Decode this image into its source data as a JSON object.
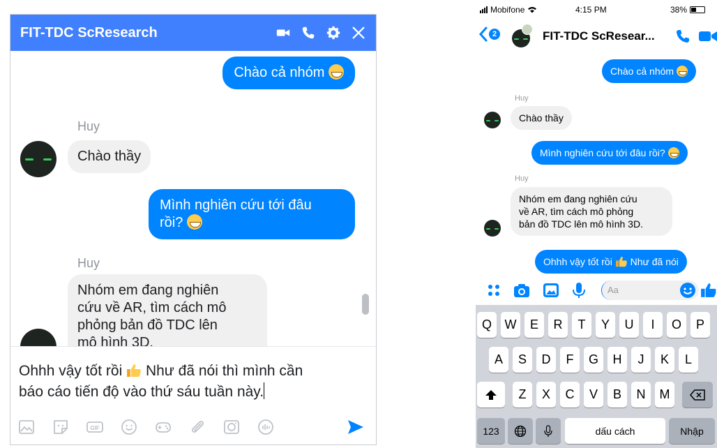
{
  "desktop": {
    "title": "FIT-TDC ScResearch",
    "messages": {
      "m1": "Chào cả nhóm",
      "sender1": "Huy",
      "m2": "Chào thầy",
      "m3_line1": "Mình nghiên cứu tới đâu",
      "m3_line2": "rồi?",
      "sender2": "Huy",
      "m4_line1": "Nhóm em đang nghiên",
      "m4_line2": "cứu về AR, tìm cách mô",
      "m4_line3": "phỏng bản đồ TDC lên",
      "m4_line4": "mô hình 3D."
    },
    "compose": {
      "line1_a": "Ohhh vậy tốt rồi",
      "line1_b": "Như đã nói thì mình cần",
      "line2": "báo cáo tiến độ vào thứ sáu tuần này."
    },
    "toolbar_icons": [
      "photo-icon",
      "sticker-icon",
      "gif-icon",
      "emoji-icon",
      "game-icon",
      "attach-icon",
      "camera-icon",
      "audio-icon",
      "send-icon"
    ],
    "gif_label": "GIF"
  },
  "mobile": {
    "status": {
      "carrier": "Mobifone",
      "time": "4:15 PM",
      "battery": "38%"
    },
    "back_badge": "2",
    "title": "FIT-TDC ScResear...",
    "messages": {
      "m1": "Chào cả nhóm",
      "sender1": "Huy",
      "m2": "Chào thầy",
      "m3": "Mình nghiên cứu tới đâu rồi?",
      "sender2": "Huy",
      "m4_line1": "Nhóm em đang nghiên cứu",
      "m4_line2": "về AR, tìm cách mô phỏng",
      "m4_line3": "bản đồ TDC lên mô hình 3D.",
      "m5_a": "Ohhh vậy tốt rồi",
      "m5_b": "Như đã nói"
    },
    "input_placeholder": "Aa",
    "keyboard": {
      "row1": [
        "Q",
        "W",
        "E",
        "R",
        "T",
        "Y",
        "U",
        "I",
        "O",
        "P"
      ],
      "row2": [
        "A",
        "S",
        "D",
        "F",
        "G",
        "H",
        "J",
        "K",
        "L"
      ],
      "row3": [
        "Z",
        "X",
        "C",
        "V",
        "B",
        "N",
        "M"
      ],
      "numbers": "123",
      "space": "dấu cách",
      "return": "Nhập"
    }
  },
  "colors": {
    "messenger_blue": "#0084ff",
    "header_blue": "#4080ff",
    "incoming_gray": "#f1f0f0"
  }
}
